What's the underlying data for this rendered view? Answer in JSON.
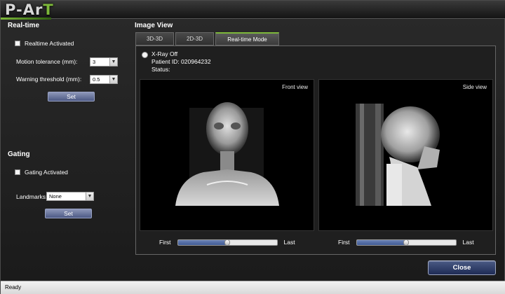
{
  "app": {
    "logo_main": "P-Ar",
    "logo_accent": "T"
  },
  "realtime": {
    "title": "Real-time",
    "activated_label": "Realtime Activated",
    "activated": false,
    "motion_tolerance_label": "Motion tolerance (mm):",
    "motion_tolerance_value": "3",
    "warning_threshold_label": "Warning threshold (mm):",
    "warning_threshold_value": "0.5",
    "set_label": "Set"
  },
  "gating": {
    "title": "Gating",
    "activated_label": "Gating Activated",
    "activated": false,
    "landmarks_label": "Landmarks:",
    "landmarks_value": "None",
    "set_label": "Set"
  },
  "image_view": {
    "title": "Image View",
    "tabs": [
      {
        "label": "3D-3D",
        "active": false
      },
      {
        "label": "2D-3D",
        "active": false
      },
      {
        "label": "Real-time Mode",
        "active": true
      }
    ],
    "xray_label": "X-Ray Off",
    "patient_id_label": "Patient ID: 020964232",
    "status_label": "Status:",
    "front_view_label": "Front view",
    "side_view_label": "Side view",
    "front_slider": {
      "first_label": "First",
      "last_label": "Last",
      "position": 0.5
    },
    "side_slider": {
      "first_label": "First",
      "last_label": "Last",
      "position": 0.5
    }
  },
  "footer": {
    "close_label": "Close",
    "status_text": "Ready"
  },
  "colors": {
    "accent_green": "#7db83a",
    "button_blue": "#4d5a85"
  }
}
